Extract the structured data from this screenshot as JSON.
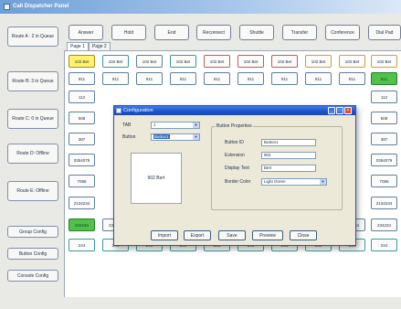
{
  "window": {
    "title": "Call Dispatcher Panel"
  },
  "sidebar": {
    "routes": [
      {
        "label": "Route A : 2 in Queue"
      },
      {
        "label": "Route B: 3 in Queue"
      },
      {
        "label": "Route C: 0 in Queue"
      },
      {
        "label": "Route D: Offline"
      },
      {
        "label": "Route E: Offline"
      }
    ],
    "config_buttons": [
      {
        "label": "Group Config"
      },
      {
        "label": "Button Config"
      },
      {
        "label": "Console Config"
      }
    ]
  },
  "toolbar": {
    "buttons": [
      {
        "label": "Answer"
      },
      {
        "label": "Hold"
      },
      {
        "label": "End"
      },
      {
        "label": "Reconnect"
      },
      {
        "label": "Shuttle"
      },
      {
        "label": "Transfer"
      },
      {
        "label": "Conference"
      },
      {
        "label": "Dial Pad"
      }
    ]
  },
  "tabs": [
    {
      "label": "Page 1"
    },
    {
      "label": "Page 2"
    }
  ],
  "grid": {
    "rows": [
      [
        "102 Bet",
        "102 Bet",
        "102 Bet",
        "102 Bet",
        "102 Bet",
        "102 Bet",
        "102 Bet",
        "102 Bet",
        "102 Bet",
        "102 Bet"
      ],
      [
        "911",
        "911",
        "911",
        "911",
        "911",
        "911",
        "911",
        "911",
        "911",
        "911"
      ],
      [
        "112",
        "",
        "",
        "",
        "",
        "",
        "",
        "",
        "",
        "112"
      ],
      [
        "508",
        "",
        "",
        "",
        "",
        "",
        "",
        "",
        "",
        "508"
      ],
      [
        "387",
        "",
        "",
        "",
        "",
        "",
        "",
        "",
        "",
        "387"
      ],
      [
        "0354079",
        "",
        "",
        "",
        "",
        "",
        "",
        "",
        "",
        "0354079"
      ],
      [
        "7086",
        "",
        "",
        "",
        "",
        "",
        "",
        "",
        "",
        "7086"
      ],
      [
        "2134234",
        "",
        "",
        "",
        "",
        "",
        "",
        "",
        "",
        "2134234"
      ],
      [
        "234234",
        "234234",
        "234234",
        "234234",
        "234234",
        "234234",
        "234234",
        "234234",
        "234234",
        "234234"
      ],
      [
        "244",
        "244",
        "244",
        "244",
        "244",
        "244",
        "244",
        "244",
        "244",
        "244"
      ]
    ]
  },
  "dialog": {
    "title": "Configuration",
    "tab_label": "TAB",
    "tab_value": "1",
    "button_label": "Button",
    "button_value": "Button1",
    "preview_text": "902 Bert",
    "properties_title": "Button Properties",
    "fields": [
      {
        "label": "Button ID",
        "value": "Button1"
      },
      {
        "label": "Extension",
        "value": "902"
      },
      {
        "label": "Display Text",
        "value": "Bert"
      }
    ],
    "border_color_label": "Border Color",
    "border_color_value": "Light Green",
    "actions": [
      {
        "label": "Import"
      },
      {
        "label": "Export"
      },
      {
        "label": "Save"
      },
      {
        "label": "Preview"
      },
      {
        "label": "Close"
      }
    ],
    "window_controls": {
      "minimize": "_",
      "maximize": "□",
      "close": "×"
    }
  },
  "colors": {
    "title_bar": "#6f9fd8",
    "dialog_title": "#1c52c8",
    "highlight_yellow": "#fff36a",
    "highlight_green": "#4fc24a",
    "close_red": "#d9512b"
  }
}
